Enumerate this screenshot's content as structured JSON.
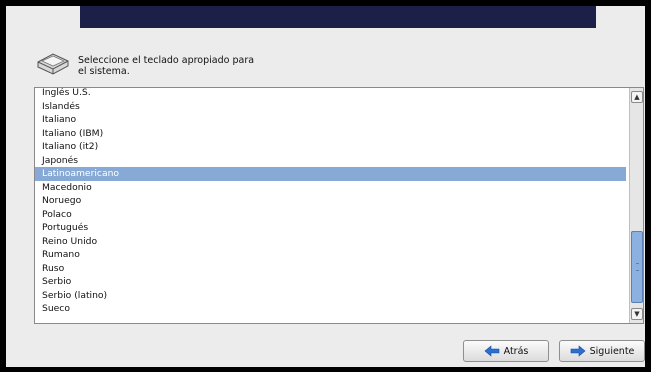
{
  "header": {
    "banner_color": "#1c1f48"
  },
  "prompt": {
    "line1": "Seleccione el teclado apropiado para",
    "line2": "el sistema.",
    "icon": "keyboard-key-icon"
  },
  "keyboard_list": {
    "selected": "Latinoamericano",
    "items": [
      "Inglés U.S.",
      "Islandés",
      "Italiano",
      "Italiano (IBM)",
      "Italiano (it2)",
      "Japonés",
      "Latinoamericano",
      "Macedonio",
      "Noruego",
      "Polaco",
      "Portugués",
      "Reino Unido",
      "Rumano",
      "Ruso",
      "Serbio",
      "Serbio (latino)",
      "Sueco"
    ]
  },
  "buttons": {
    "back_label": "Atrás",
    "next_label": "Siguiente",
    "back_icon": "arrow-left-icon",
    "next_icon": "arrow-right-icon",
    "arrow_color": "#2a6fd1"
  },
  "colors": {
    "selection": "#86a9d6",
    "window_bg": "#ececec"
  }
}
